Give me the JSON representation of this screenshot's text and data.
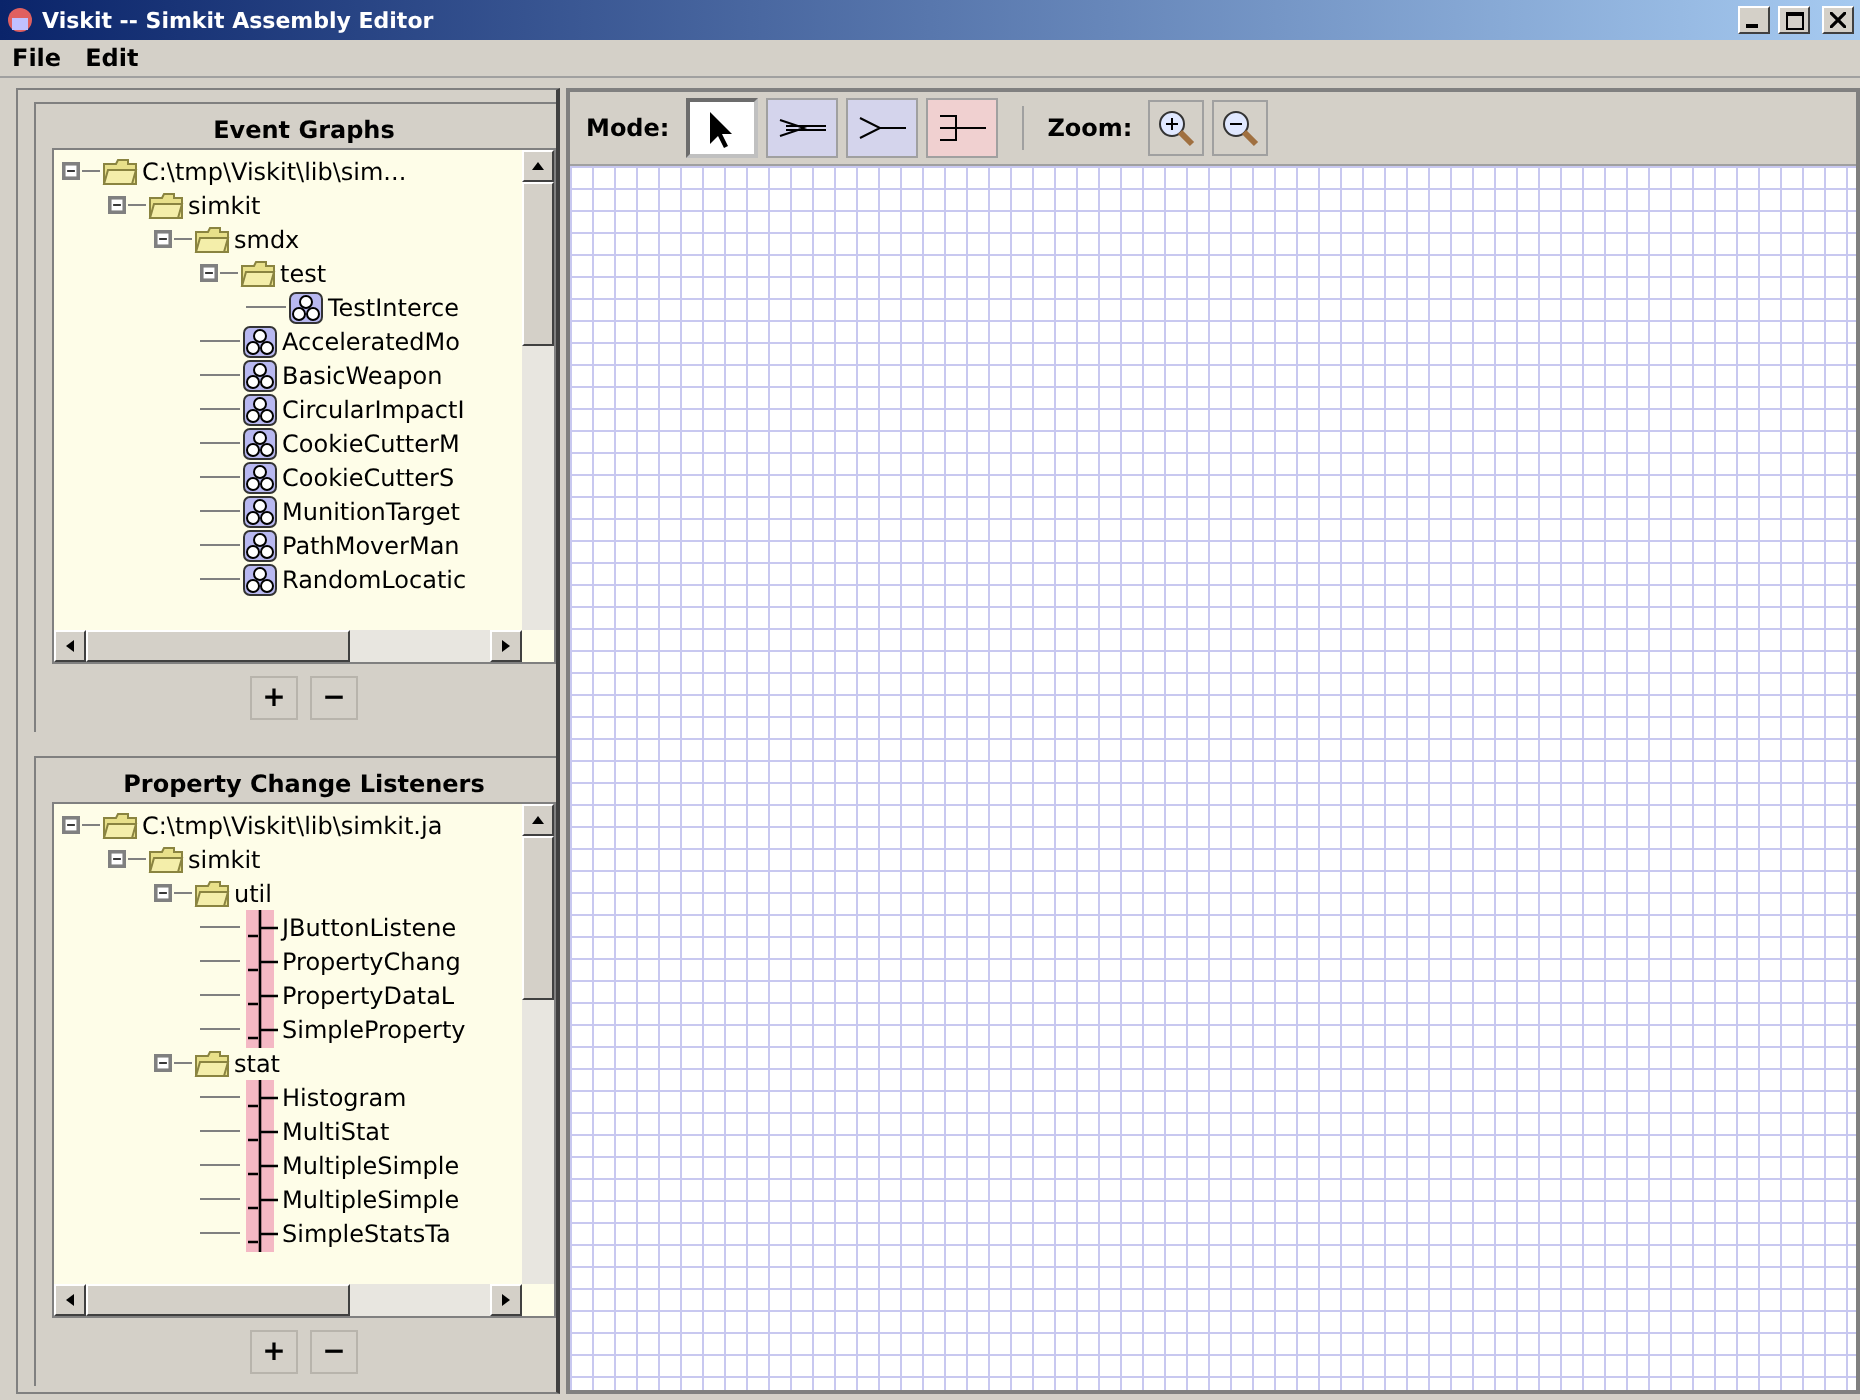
{
  "window": {
    "title": "Viskit -- Simkit Assembly Editor"
  },
  "menu": [
    "File",
    "Edit"
  ],
  "panels": [
    {
      "title": "Event Graphs",
      "tree": [
        {
          "label": "C:\\tmp\\Viskit\\lib\\sim...",
          "kind": "folder",
          "expanded": true,
          "children": [
            {
              "label": "simkit",
              "kind": "folder",
              "expanded": true,
              "children": [
                {
                  "label": "smdx",
                  "kind": "folder",
                  "expanded": true,
                  "children": [
                    {
                      "label": "test",
                      "kind": "folder",
                      "expanded": true,
                      "children": [
                        {
                          "label": "TestInterce",
                          "kind": "graph"
                        }
                      ]
                    },
                    {
                      "label": "AcceleratedMo",
                      "kind": "graph"
                    },
                    {
                      "label": "BasicWeapon",
                      "kind": "graph"
                    },
                    {
                      "label": "CircularImpactI",
                      "kind": "graph"
                    },
                    {
                      "label": "CookieCutterM",
                      "kind": "graph"
                    },
                    {
                      "label": "CookieCutterS",
                      "kind": "graph"
                    },
                    {
                      "label": "MunitionTarget",
                      "kind": "graph"
                    },
                    {
                      "label": "PathMoverMan",
                      "kind": "graph"
                    },
                    {
                      "label": "RandomLocatic",
                      "kind": "graph"
                    }
                  ]
                }
              ]
            }
          ]
        }
      ],
      "buttons": [
        "+",
        "−"
      ]
    },
    {
      "title": "Property Change Listeners",
      "tree": [
        {
          "label": "C:\\tmp\\Viskit\\lib\\simkit.ja",
          "kind": "folder",
          "expanded": true,
          "children": [
            {
              "label": "simkit",
              "kind": "folder",
              "expanded": true,
              "children": [
                {
                  "label": "util",
                  "kind": "folder",
                  "expanded": true,
                  "children": [
                    {
                      "label": "JButtonListene",
                      "kind": "listener"
                    },
                    {
                      "label": "PropertyChang",
                      "kind": "listener"
                    },
                    {
                      "label": "PropertyDataL",
                      "kind": "listener"
                    },
                    {
                      "label": "SimpleProperty",
                      "kind": "listener"
                    }
                  ]
                },
                {
                  "label": "stat",
                  "kind": "folder",
                  "expanded": true,
                  "children": [
                    {
                      "label": "Histogram",
                      "kind": "listener"
                    },
                    {
                      "label": "MultiStat",
                      "kind": "listener"
                    },
                    {
                      "label": "MultipleSimple",
                      "kind": "listener"
                    },
                    {
                      "label": "MultipleSimple",
                      "kind": "listener"
                    },
                    {
                      "label": "SimpleStatsTa",
                      "kind": "listener"
                    }
                  ]
                }
              ]
            }
          ]
        }
      ],
      "buttons": [
        "+",
        "−"
      ]
    }
  ],
  "toolbar": {
    "mode_label": "Mode:",
    "modes": [
      {
        "kind": "select",
        "selected": true
      },
      {
        "kind": "adapter",
        "selected": false
      },
      {
        "kind": "simevent",
        "selected": false
      },
      {
        "kind": "propchange",
        "selected": false
      }
    ],
    "zoom_label": "Zoom:",
    "zoom": [
      {
        "kind": "in"
      },
      {
        "kind": "out"
      }
    ]
  }
}
